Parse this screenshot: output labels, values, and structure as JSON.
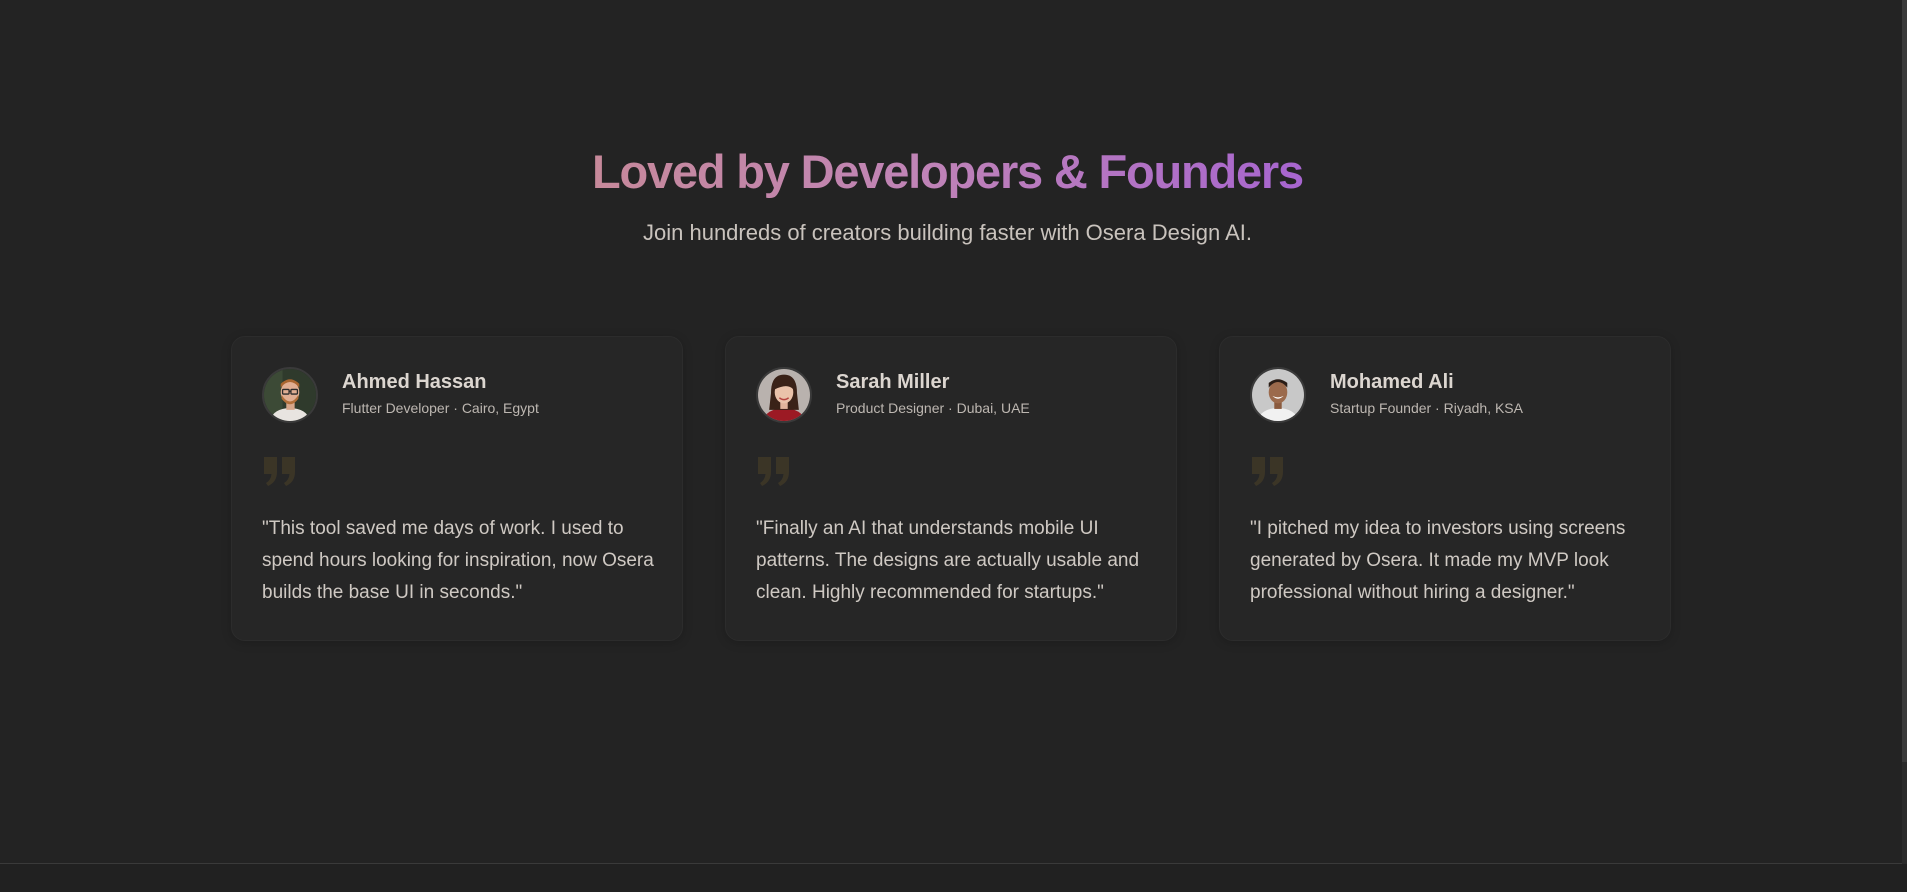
{
  "section": {
    "title": "Loved by Developers & Founders",
    "subtitle": "Join hundreds of creators building faster with Osera Design AI."
  },
  "testimonials": [
    {
      "name": "Ahmed Hassan",
      "role": "Flutter Developer · Cairo, Egypt",
      "quote": "\"This tool saved me days of work. I used to spend hours looking for inspiration, now Osera builds the base UI in seconds.\"",
      "avatar_icon": "avatar-man-glasses"
    },
    {
      "name": "Sarah Miller",
      "role": "Product Designer · Dubai, UAE",
      "quote": "\"Finally an AI that understands mobile UI patterns. The designs are actually usable and clean. Highly recommended for startups.\"",
      "avatar_icon": "avatar-woman"
    },
    {
      "name": "Mohamed Ali",
      "role": "Startup Founder · Riyadh, KSA",
      "quote": "\"I pitched my idea to investors using screens generated by Osera. It made my MVP look professional without hiring a designer.\"",
      "avatar_icon": "avatar-man-smiling"
    }
  ],
  "colors": {
    "background": "#232323",
    "card": "#262626",
    "title_gradient_start": "#c6899a",
    "title_gradient_end": "#a765cf",
    "quote_mark": "#3b3526"
  }
}
